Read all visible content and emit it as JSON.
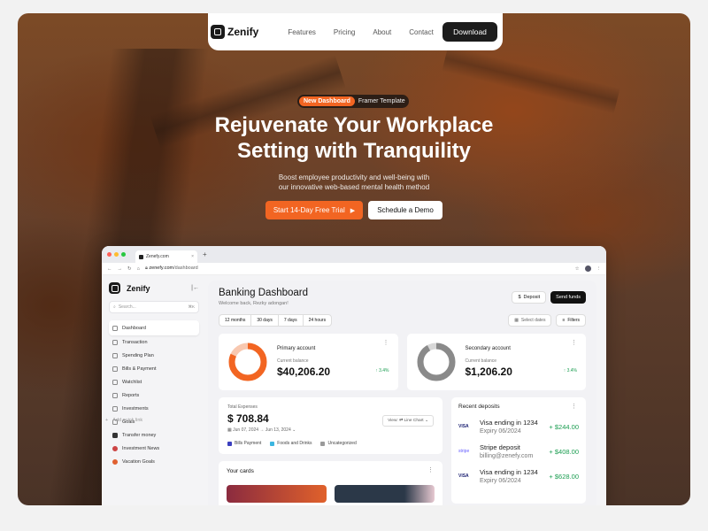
{
  "nav": {
    "brand": "Zenify",
    "links": [
      "Features",
      "Pricing",
      "About",
      "Contact"
    ],
    "download": "Download"
  },
  "hero": {
    "pill_new": "New Dashboard",
    "pill_text": "Framer Template",
    "title_line1": "Rejuvenate Your Workplace",
    "title_line2": "Setting with Tranquility",
    "sub_line1": "Boost employee productivity and well-being with",
    "sub_line2": "our innovative web-based mental health method",
    "cta_primary": "Start 14-Day Free Trial",
    "cta_secondary": "Schedule a Demo"
  },
  "browser": {
    "tab_title": "Zenefy.com",
    "url_domain": "zenefy.com",
    "url_path": "/dashboard"
  },
  "sidebar": {
    "brand": "Zenify",
    "search_placeholder": "Search...",
    "search_shortcut": "⌘K",
    "items": [
      "Dashboard",
      "Transaction",
      "Spending Plan",
      "Bills & Payment",
      "Watchlist",
      "Reports",
      "Investments",
      "Goals"
    ],
    "add_quick_link": "Add quick link",
    "quick_links": [
      "Transfer money",
      "Investment News",
      "Vacation Goals"
    ]
  },
  "dashboard": {
    "title": "Banking Dashboard",
    "welcome": "Welcome back, Rezky adongan!",
    "deposit": "Deposit",
    "send_funds": "Send funds",
    "ranges": [
      "12 months",
      "30 days",
      "7 days",
      "24 hours"
    ],
    "select_dates": "Select dates",
    "filters": "Filters",
    "primary": {
      "name": "Primary account",
      "label": "Current balance",
      "amount": "$40,206.20",
      "change": "↑ 3.4%",
      "ring_fill": 0.82
    },
    "secondary": {
      "name": "Secondary account",
      "label": "Current balance",
      "amount": "$1,206.20",
      "change": "↑ 3.4%",
      "ring_fill": 0.92
    },
    "expenses": {
      "label": "Total Expenses",
      "value": "$ 708.84",
      "dates": "Jun 07, 2024 → Jun 13, 2024",
      "view_label": "View:",
      "view_value": "Line Chart",
      "legend": [
        {
          "name": "Bills Payment",
          "color": "#3b3fbf"
        },
        {
          "name": "Foods and Drinks",
          "color": "#3cb6e0"
        },
        {
          "name": "Uncategorized",
          "color": "#9a9a9a"
        }
      ]
    },
    "deposits": {
      "title": "Recent deposits",
      "rows": [
        {
          "logo": "VISA",
          "name": "Visa ending in 1234",
          "sub": "Expiry 06/2024",
          "amount": "+ $244.00"
        },
        {
          "logo": "stripe",
          "name": "Stripe deposit",
          "sub": "billing@zenefy.com",
          "amount": "+ $408.00"
        },
        {
          "logo": "VISA",
          "name": "Visa ending in 1234",
          "sub": "Expiry 06/2024",
          "amount": "+ $628.00"
        }
      ]
    },
    "your_cards": "Your cards"
  },
  "colors": {
    "accent": "#f26522",
    "dark": "#1c1c1c",
    "positive": "#1a9d50"
  }
}
